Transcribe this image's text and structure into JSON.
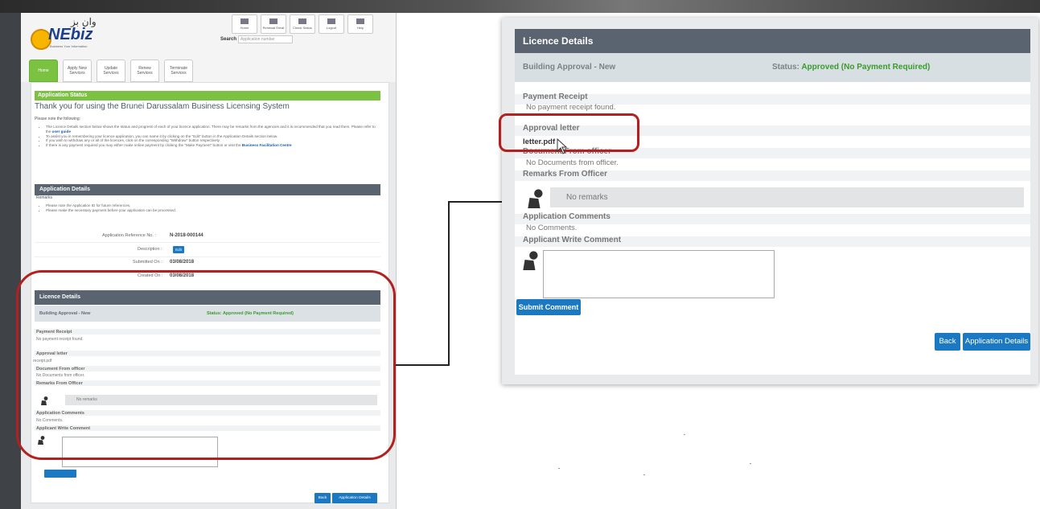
{
  "header": {
    "logo_arabic": "وان بز",
    "logo_text": "NEbiz",
    "logo_subtitle": "Business Your Information",
    "top_icons": [
      {
        "label": "Home",
        "icon": "home-icon"
      },
      {
        "label": "Renewal Email",
        "icon": "email-icon"
      },
      {
        "label": "Check Status",
        "icon": "status-icon"
      },
      {
        "label": "Logout",
        "icon": "logout-icon"
      },
      {
        "label": "Help",
        "icon": "help-icon"
      }
    ],
    "search_label": "Search",
    "search_placeholder": "Application number"
  },
  "tabs": [
    {
      "label": "Home"
    },
    {
      "label": "Apply New Services"
    },
    {
      "label": "Update Services"
    },
    {
      "label": "Renew Services"
    },
    {
      "label": "Terminate Services"
    }
  ],
  "application_status": {
    "bar_title": "Application Status",
    "thanks": "Thank you for using the Brunei Darussalam Business Licensing System",
    "please_note": "Please note the following:",
    "bullets": [
      "The Licence Details section below shows the status and progress of each of your licence application. There may be remarks from the agencies and it is recommended that you read them. Please refer to the",
      "To assist you in remembering your licence application, you can name it by clicking on the \"Edit\" button in the Application Details section below.",
      "If you wish to withdraw any or all of the licences, click on the corresponding \"Withdraw\" button respectively.",
      "If there is any payment required you may either make online payment by clicking the \"Make Payment\" button or visit the"
    ],
    "user_guide_link": "user guide",
    "bfc_link": "Business Facilitation Centre"
  },
  "application_details": {
    "bar_title": "Application Details",
    "remarks_label": "Remarks",
    "remarks": [
      "Please note the Application ID for future references.",
      "Please make the necessary payment before your application can be processed."
    ],
    "reference_label": "Application Reference No. :",
    "reference_value": "N-2018-000144",
    "description_label": "Description :",
    "edit_label": "Edit",
    "submitted_label": "Submitted On :",
    "submitted_value": "03/08/2018",
    "created_label": "Created On :",
    "created_value": "03/08/2018"
  },
  "licence_details_small": {
    "title": "Licence Details",
    "licence_name": "Building Approval - New",
    "status_text": "Status: Approved (No Payment Required)",
    "payment_receipt_title": "Payment Receipt",
    "payment_receipt_value": "No payment receipt found.",
    "approval_letter_title": "Approval letter",
    "approval_letter_value": "receipt.pdf",
    "document_officer_title": "Document From officer",
    "document_officer_value": "No Documents from officer.",
    "remarks_officer_title": "Remarks From Officer",
    "no_remarks": "No remarks",
    "app_comments_title": "Application Comments",
    "app_comments_value": "No Comments.",
    "write_comment_title": "Applicant Write Comment",
    "back_label": "Back",
    "app_details_label": "Application Details"
  },
  "licence_details_zoom": {
    "title": "Licence Details",
    "licence_name": "Building Approval - New",
    "status_label": "Status:",
    "status_value": "Approved (No Payment Required)",
    "payment_receipt_title": "Payment Receipt",
    "payment_receipt_value": "No payment receipt found.",
    "approval_letter_title": "Approval letter",
    "approval_letter_value": "letter.pdf",
    "document_officer_title": "Document From officer",
    "document_officer_value": "No Documents from officer.",
    "remarks_officer_title": "Remarks From Officer",
    "no_remarks": "No remarks",
    "app_comments_title": "Application Comments",
    "app_comments_value": "No Comments.",
    "write_comment_title": "Applicant Write Comment",
    "submit_label": "Submit Comment",
    "back_label": "Back",
    "app_details_label": "Application Details"
  },
  "colors": {
    "accent_green": "#7cc242",
    "header_slate": "#5a6470",
    "button_blue": "#1b78c2",
    "status_green": "#3a9a2e",
    "highlight_red": "#b22020"
  }
}
